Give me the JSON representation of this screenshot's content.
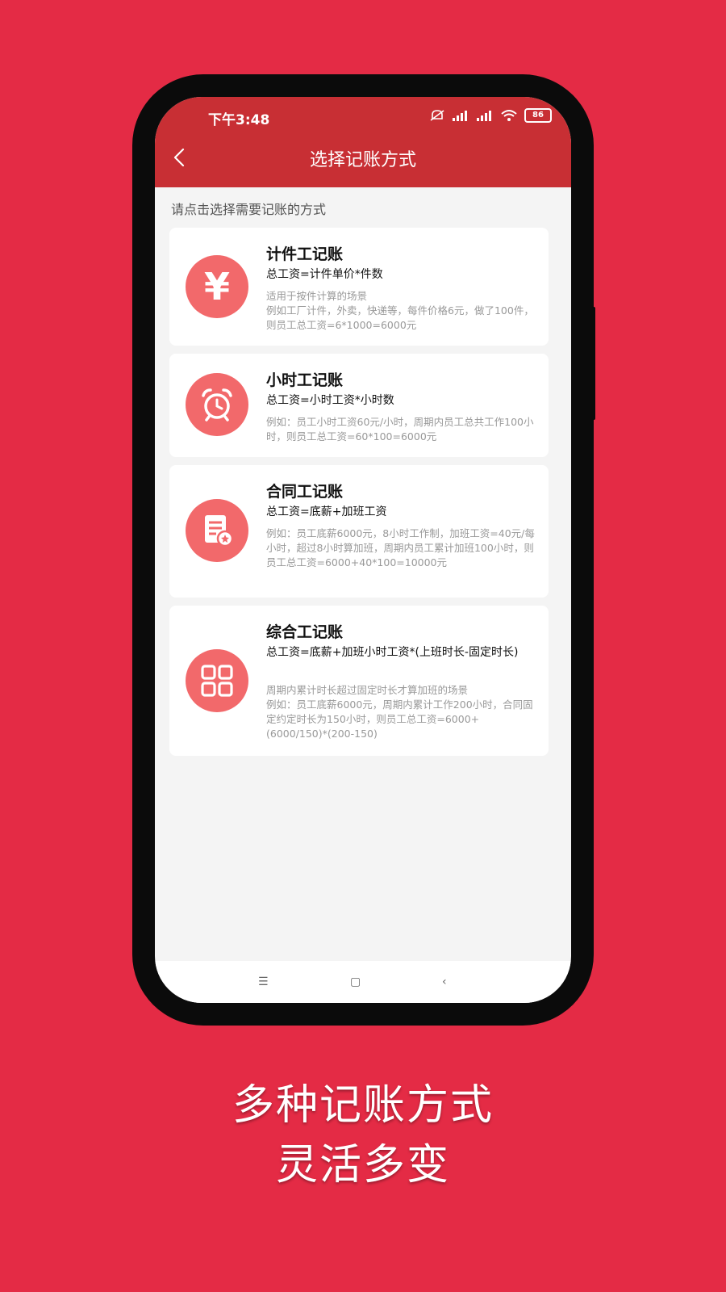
{
  "status_bar": {
    "time": "下午3:48",
    "battery": "86"
  },
  "nav": {
    "title": "选择记账方式"
  },
  "hint": "请点击选择需要记账的方式",
  "cards": [
    {
      "title": "计件工记账",
      "formula": "总工资=计件单价*件数",
      "desc": [
        "适用于按件计算的场景",
        "例如工厂计件，外卖，快递等，每件价格6元，做了100件，则员工总工资=6*1000=6000元"
      ],
      "icon": "yen-icon"
    },
    {
      "title": "小时工记账",
      "formula": "总工资=小时工资*小时数",
      "desc": [
        "例如：员工小时工资60元/小时，周期内员工总共工作100小时，则员工总工资=60*100=6000元"
      ],
      "icon": "alarm-clock-icon"
    },
    {
      "title": "合同工记账",
      "formula": "总工资=底薪+加班工资",
      "desc": [
        "例如：员工底薪6000元，8小时工作制，加班工资=40元/每小时，超过8小时算加班，周期内员工累计加班100小时，则员工总工资=6000+40*100=10000元"
      ],
      "icon": "contract-document-icon"
    },
    {
      "title": "综合工记账",
      "formula": "总工资=底薪+加班小时工资*(上班时长-固定时长)",
      "desc": [
        "周期内累计时长超过固定时长才算加班的场景",
        "例如：员工底薪6000元，周期内累计工作200小时，合同固定约定时长为150小时，则员工总工资=6000+(6000/150)*(200-150)"
      ],
      "icon": "grid-icon"
    }
  ],
  "caption": {
    "line1": "多种记账方式",
    "line2": "灵活多变"
  },
  "colors": {
    "background": "#e42b45",
    "header": "#c82f34",
    "icon_circle": "#f2696b"
  }
}
